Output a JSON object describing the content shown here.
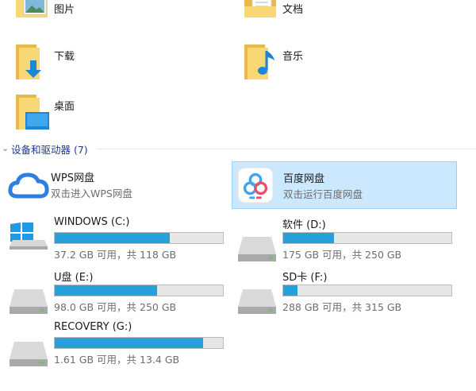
{
  "folders": [
    {
      "label": "图片",
      "icon": "pictures-folder-icon"
    },
    {
      "label": "文档",
      "icon": "documents-folder-icon"
    },
    {
      "label": "下载",
      "icon": "downloads-folder-icon"
    },
    {
      "label": "音乐",
      "icon": "music-folder-icon"
    },
    {
      "label": "桌面",
      "icon": "desktop-folder-icon"
    }
  ],
  "devices_section": {
    "title": "设备和驱动器 (7)"
  },
  "cloud": [
    {
      "name": "WPS网盘",
      "subtitle": "双击进入WPS网盘",
      "icon": "wps-cloud-icon",
      "selected": false
    },
    {
      "name": "百度网盘",
      "subtitle": "双击运行百度网盘",
      "icon": "baidu-netdisk-icon",
      "selected": true
    }
  ],
  "drives": [
    {
      "name": "WINDOWS (C:)",
      "capacity": "37.2 GB 可用，共 118 GB",
      "used_fraction": 0.685,
      "icon": "windows-drive-icon"
    },
    {
      "name": "软件 (D:)",
      "capacity": "175 GB 可用，共 250 GB",
      "used_fraction": 0.3,
      "icon": "hard-drive-icon"
    },
    {
      "name": "U盘 (E:)",
      "capacity": "98.0 GB 可用，共 250 GB",
      "used_fraction": 0.608,
      "icon": "hard-drive-icon"
    },
    {
      "name": "SD卡 (F:)",
      "capacity": "288 GB 可用，共 315 GB",
      "used_fraction": 0.086,
      "icon": "hard-drive-icon"
    },
    {
      "name": "RECOVERY (G:)",
      "capacity": "1.61 GB 可用，共 13.4 GB",
      "used_fraction": 0.88,
      "icon": "hard-drive-icon"
    }
  ],
  "colors": {
    "accent": "#26a0da",
    "selection": "#cce8ff",
    "selection_border": "#99d1ff",
    "section_title": "#1e3a8a",
    "folder": "#f8d775"
  }
}
